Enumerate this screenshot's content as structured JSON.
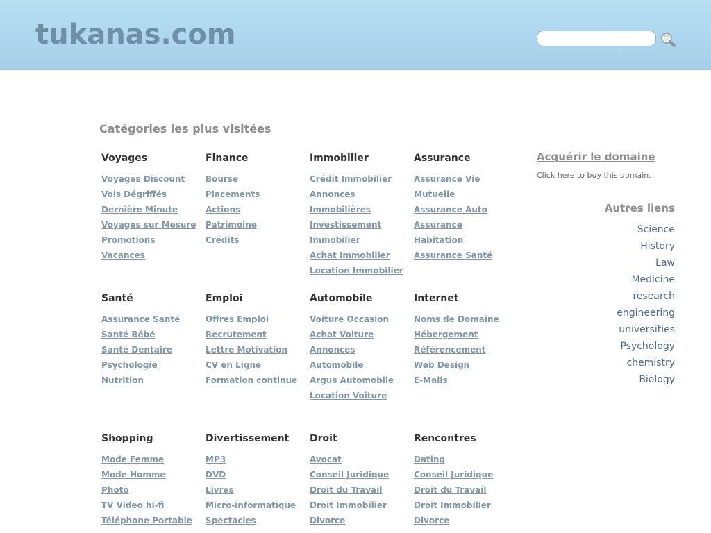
{
  "header": {
    "site_title": "tukanas.com",
    "search_value": "",
    "search_icon": "magnifier-icon"
  },
  "categories_section": {
    "title": "Catégories les plus visitées",
    "rows": [
      [
        {
          "title": "Voyages",
          "links": [
            "Voyages Discount",
            "Vols Dégriffés",
            "Dernière Minute",
            "Voyages sur Mesure",
            "Promotions",
            "Vacances"
          ]
        },
        {
          "title": "Finance",
          "links": [
            "Bourse",
            "Placements",
            "Actions",
            "Patrimoine",
            "Crédits"
          ]
        },
        {
          "title": "Immobilier",
          "links": [
            "Crédit Immobilier",
            "Annonces",
            "Immobilières",
            "Investissement",
            "Immobilier",
            "Achat Immobilier",
            "Location Immobilier"
          ]
        },
        {
          "title": "Assurance",
          "links": [
            "Assurance Vie",
            "Mutuelle",
            "Assurance Auto",
            "Assurance",
            "Habitation",
            "Assurance Santé"
          ]
        }
      ],
      [
        {
          "title": "Santé",
          "links": [
            "Assurance Santé",
            "Santé Bébé",
            "Santé Dentaire",
            "Psychologie",
            "Nutrition"
          ]
        },
        {
          "title": "Emploi",
          "links": [
            "Offres Emploi",
            "Recrutement",
            "Lettre Motivation",
            "CV en Ligne",
            "Formation continue"
          ]
        },
        {
          "title": "Automobile",
          "links": [
            "Voiture Occasion",
            "Achat Voiture",
            "Annonces",
            "Automobile",
            "Argus Automobile",
            "Location Voiture"
          ]
        },
        {
          "title": "Internet",
          "links": [
            "Noms de Domaine",
            "Hébergement",
            "Référencement",
            "Web Design",
            "E-Mails"
          ]
        }
      ],
      [
        {
          "title": "Shopping",
          "links": [
            "Mode Femme",
            "Mode Homme",
            "Photo",
            "TV Video hi-fi",
            "Téléphone Portable"
          ]
        },
        {
          "title": "Divertissement",
          "links": [
            "MP3",
            "DVD",
            "Livres",
            "Micro-informatique",
            "Spectacles"
          ]
        },
        {
          "title": "Droit",
          "links": [
            "Avocat",
            "Conseil Juridique",
            "Droit du Travail",
            "Droit Immobilier",
            "Divorce"
          ]
        },
        {
          "title": "Rencontres",
          "links": [
            "Dating",
            "Conseil Juridique",
            "Droit du Travail",
            "Droit Immobilier",
            "Divorce"
          ]
        }
      ]
    ]
  },
  "sidebar": {
    "buy_link": "Acquérir le domaine",
    "buy_desc": "Click here to buy this domain.",
    "other_title": "Autres liens",
    "other_links": [
      "Science",
      "History",
      "Law",
      "Medicine",
      "research",
      "engineering",
      "universities",
      "Psychology",
      "chemistry",
      "Biology"
    ]
  }
}
